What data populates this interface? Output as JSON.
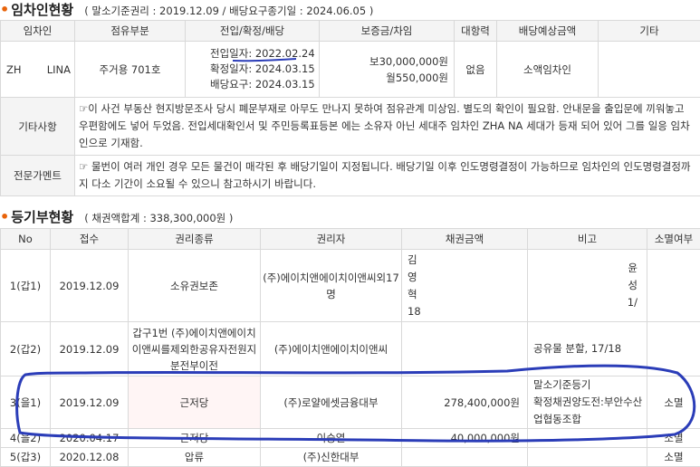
{
  "tenant_section": {
    "title": "임차인현황",
    "subtitle": "( 말소기준권리 : 2019.12.09 / 배당요구종기일 : 2024.06.05 )",
    "headers": [
      "임차인",
      "점유부분",
      "전입/확정/배당",
      "보증금/차임",
      "대항력",
      "배당예상금액",
      "기타"
    ],
    "row": {
      "name_a": "ZH",
      "name_b": "LINA",
      "part": "주거용 701호",
      "move_in": "전입일자: 2022.02.24",
      "confirm": "확정일자: 2024.03.15",
      "demand": "배당요구: 2024.03.15",
      "deposit": "보30,000,000원",
      "rent": "월550,000원",
      "opposing": "없음",
      "expected": "소액임차인",
      "etc": ""
    },
    "other_label": "기타사항",
    "other_text": "☞이 사건 부동산 현지방문조사 당시 폐문부재로 아무도 만나지 못하여 점유관계 미상임. 별도의 확인이 필요함. 안내문을 출입문에 끼워놓고 우편함에도 넣어 두었음. 전입세대확인서 및 주민등록표등본 에는 소유자 아닌 세대주 임차인 ZHA      NA 세대가 등재 되어 있어 그를 일응 임차인으로 기재함.",
    "expert_label": "전문가멘트",
    "expert_text": "☞ 물번이 여러 개인 경우 모든 물건이 매각된 후 배당기일이 지정됩니다. 배당기일 이후 인도명령결정이 가능하므로 임차인의 인도명령결정까지 다소 기간이 소요될 수 있으니 참고하시기 바랍니다."
  },
  "registry_section": {
    "title": "등기부현황",
    "subtitle": "( 채권액합계 : 338,300,000원 )",
    "headers": [
      "No",
      "접수",
      "권리종류",
      "권리자",
      "채권금액",
      "비고",
      "소멸여부"
    ],
    "rows": [
      {
        "no": "1(갑1)",
        "date": "2019.12.09",
        "type": "소유권보존",
        "holder": "(주)에이치앤에이치이앤씨외17명",
        "amount_l": "김\n영\n혁\n18",
        "amount_r": "",
        "note_l": "",
        "note_r": "윤\n성\n1/",
        "status": ""
      },
      {
        "no": "2(갑2)",
        "date": "2019.12.09",
        "type": "갑구1번 (주)에이치앤에이치이앤씨를제외한공유자전원지분전부이전",
        "holder": "(주)에이치앤에이치이앤씨",
        "amount_l": "",
        "amount_r": "",
        "note_l": "공유물 분할, 17/18",
        "note_r": "",
        "status": ""
      },
      {
        "no": "3(을1)",
        "date": "2019.12.09",
        "type": "근저당",
        "holder": "(주)로얄에셋금융대부",
        "amount_l": "",
        "amount_r": "278,400,000원",
        "note_l": "말소기준등기\n확정채권양도전:부안수산업협동조합",
        "note_r": "",
        "status": "소멸"
      },
      {
        "no": "4(을2)",
        "date": "2020.04.17",
        "type": "근저당",
        "holder": "이승열",
        "amount_l": "",
        "amount_r": "40,000,000원",
        "note_l": "",
        "note_r": "",
        "status": "소멸"
      },
      {
        "no": "5(갑3)",
        "date": "2020.12.08",
        "type": "압류",
        "holder": "(주)신한대부",
        "amount_l": "",
        "amount_r": "",
        "note_l": "",
        "note_r": "",
        "status": "소멸"
      }
    ]
  },
  "colors": {
    "accent": "#e8630a",
    "annotation": "#2b3db8",
    "header_bg": "#f4f4f4"
  }
}
